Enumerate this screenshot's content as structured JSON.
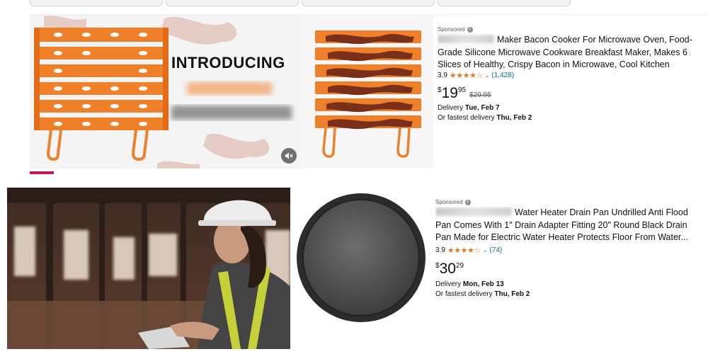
{
  "ad1": {
    "video_overlay_title": "INTRODUCING",
    "sponsored": "Sponsored",
    "title": "Maker Bacon Cooker For Microwave Oven, Food-Grade Silicone Microwave Cookware Breakfast Maker, Makes 6 Slices of Healthy, Crispy Bacon in Microwave, Cool Kitchen Gadge...",
    "rating": "3.9",
    "review_count": "(1,428)",
    "price_currency": "$",
    "price_whole": "19",
    "price_fraction": "95",
    "list_price": "$29.95",
    "delivery_label": "Delivery ",
    "delivery_date": "Tue, Feb 7",
    "fastest_label": "Or fastest delivery ",
    "fastest_date": "Thu, Feb 2",
    "mute_icon": "speaker-muted-icon"
  },
  "ad2": {
    "sponsored": "Sponsored",
    "title": "Water Heater Drain Pan Undrilled Anti Flood Pan Comes With 1\" Drain Adapter Fitting 20\" Round Black Drain Pan Made for Electric Water Heater Protects Floor From Water...",
    "rating": "3.9",
    "review_count": "(74)",
    "price_currency": "$",
    "price_whole": "30",
    "price_fraction": "29",
    "delivery_label": "Delivery ",
    "delivery_date": "Mon, Feb 13",
    "fastest_label": "Or fastest delivery ",
    "fastest_date": "Thu, Feb 2"
  },
  "colors": {
    "star": "#de7921",
    "link": "#007185",
    "progress": "#c7145a",
    "product_orange": "#f07f2a"
  }
}
